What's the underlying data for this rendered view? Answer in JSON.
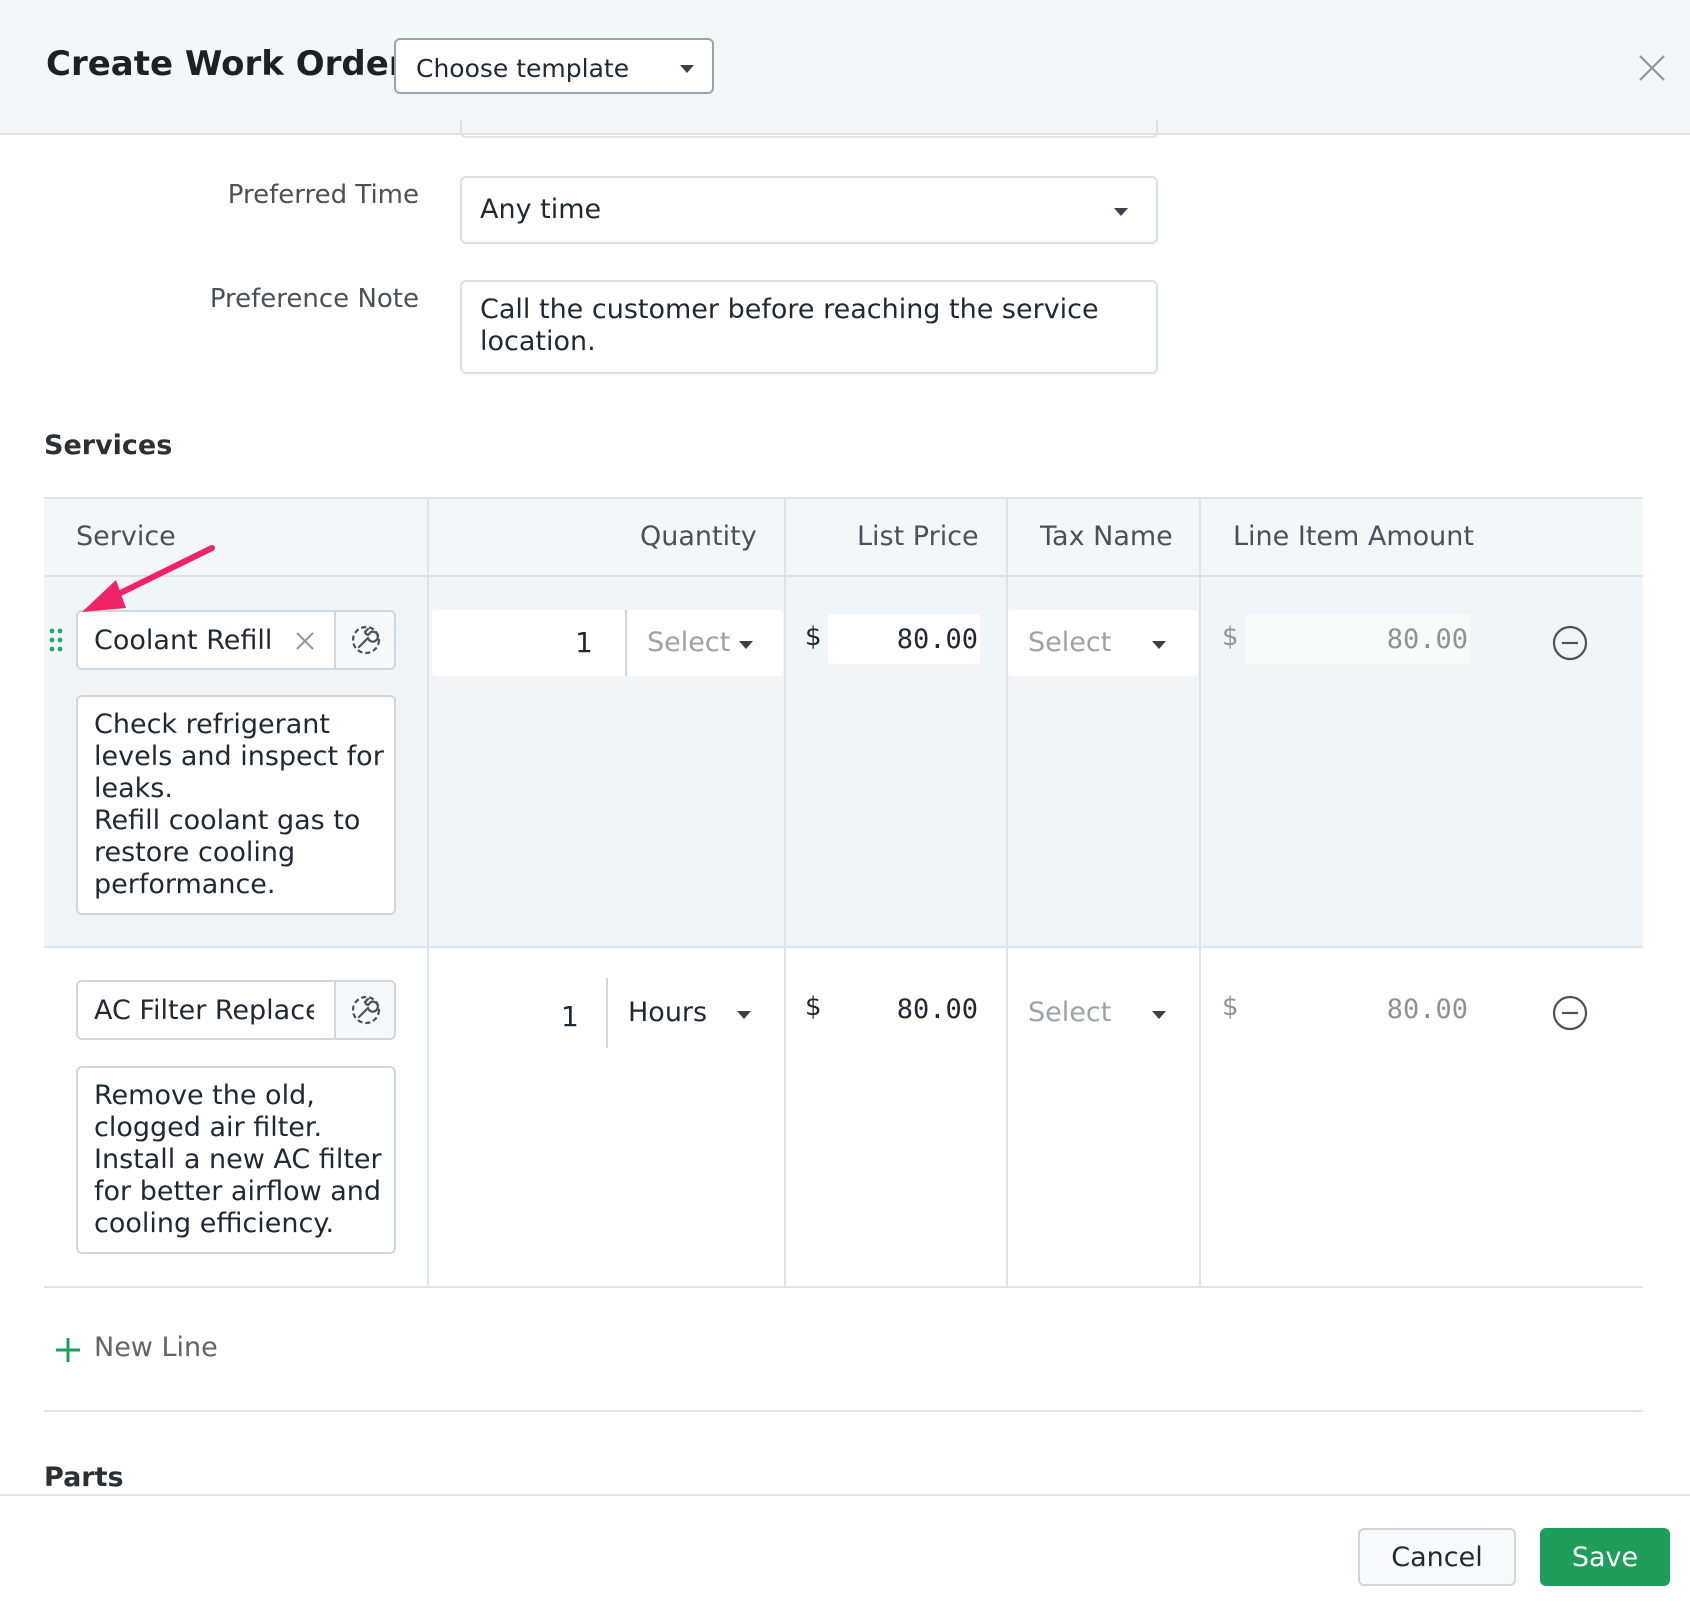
{
  "header": {
    "title": "Create Work Order",
    "template_select": {
      "value": "Choose template"
    },
    "close_icon": "close-icon"
  },
  "form": {
    "preferred_time": {
      "label": "Preferred Time",
      "value": "Any time"
    },
    "preference_note": {
      "label": "Preference Note",
      "value": "Call the customer before reaching the service location."
    }
  },
  "services": {
    "section_title": "Services",
    "columns": [
      "Service",
      "Quantity",
      "List Price",
      "Tax Name",
      "Line Item Amount"
    ],
    "rows": [
      {
        "service_name": "Coolant Refill",
        "description": "Check refrigerant levels and inspect for leaks.\nRefill coolant gas to restore cooling performance.",
        "quantity": "1",
        "unit": "Select",
        "currency": "$",
        "list_price": "80.00",
        "tax_name": "Select",
        "amount_currency": "$",
        "line_item_amount": "80.00"
      },
      {
        "service_name": "AC Filter Replace",
        "description": "Remove the old, clogged air filter.\nInstall a new AC filter for better airflow and cooling efficiency.",
        "quantity": "1",
        "unit": "Hours",
        "currency": "$",
        "list_price": "80.00",
        "tax_name": "Select",
        "amount_currency": "$",
        "line_item_amount": "80.00"
      }
    ],
    "new_line_label": "New Line"
  },
  "parts": {
    "section_title": "Parts"
  },
  "footer": {
    "cancel_label": "Cancel",
    "save_label": "Save"
  },
  "colors": {
    "accent": "#1f9d5a",
    "annotation_arrow": "#ee2466",
    "header_bg": "#f4f7f8"
  }
}
